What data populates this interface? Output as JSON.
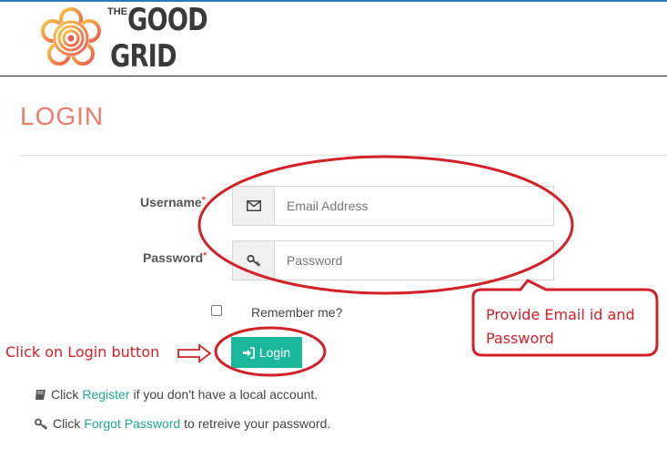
{
  "header": {
    "logo_the": "THE",
    "logo_good": "GOOD",
    "logo_grid": "GRID"
  },
  "page": {
    "title": "LOGIN"
  },
  "form": {
    "username_label": "Username",
    "username_placeholder": "Email Address",
    "password_label": "Password",
    "password_placeholder": "Password",
    "required_mark": "*",
    "remember_label": "Remember me?",
    "login_button": "Login"
  },
  "help": {
    "register": {
      "prefix": "Click",
      "link": "Register",
      "suffix": "if you don't have a local account."
    },
    "forgot": {
      "prefix": "Click",
      "link": "Forgot Password",
      "suffix": "to retreive your password."
    }
  },
  "annotations": {
    "left_note": "Click on Login button",
    "right_note": "Provide Email id and Password"
  },
  "colors": {
    "accent_title": "#f07b6a",
    "button": "#1bb79b",
    "link": "#1fa88f",
    "annotation": "#d42027"
  },
  "icons": {
    "logo": "gear-flower-logo",
    "username_addon": "envelope-icon",
    "password_addon": "key-icon",
    "button": "sign-in-icon",
    "register": "book-icon",
    "forgot": "key-icon"
  }
}
